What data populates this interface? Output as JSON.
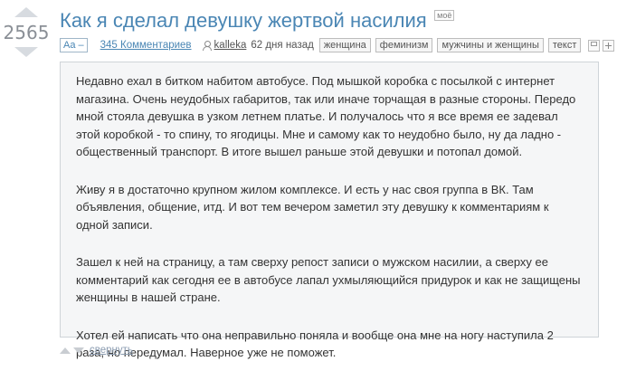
{
  "vote": {
    "rating": "2565"
  },
  "post": {
    "title": "Как я сделал девушку жертвой насилия",
    "moe_tag": "моё",
    "aa_button": "Aa –",
    "comments": "345 Комментариев",
    "author": "kalleka",
    "posted": "62 дня назад",
    "tags": [
      "женщина",
      "феминизм",
      "мужчины и женщины",
      "текст"
    ],
    "paragraphs": [
      "Недавно ехал в битком набитом автобусе. Под мышкой коробка с посылкой с интернет магазина. Очень неудобных габаритов, так или иначе торчащая в разные стороны. Передо мной стояла девушка в узком летнем платье. И получалось что я все время ее задевал этой коробкой - то  спину, то  ягодицы. Мне и самому как то неудобно было, ну да ладно - общественный транспорт. В итоге вышел раньше этой девушки и потопал домой.",
      "Живу я в достаточно крупном жилом комплексе. И есть у нас своя группа в ВК. Там объявления, общение, итд. И вот тем вечером заметил эту девушку к комментариям к одной записи.",
      "Зашел к ней на страницу,  а там сверху репост  записи о мужском насилии, а сверху ее комментарий как сегодня ее в автобусе лапал ухмыляющийся придурок и как не защищены женщины в нашей стране.",
      "Хотел ей написать что она неправильно поняла и вообще она мне на ногу наступила 2 раза, но передумал. Наверное уже не поможет."
    ],
    "collapse_label": "свернуть"
  },
  "colors": {
    "title": "#4a86b4",
    "box_bg": "#f5f6f7",
    "arrow": "#d7dbe0"
  },
  "icons": [
    "upvote-arrow-icon",
    "downvote-arrow-icon",
    "user-icon",
    "save-icon",
    "add-icon"
  ]
}
